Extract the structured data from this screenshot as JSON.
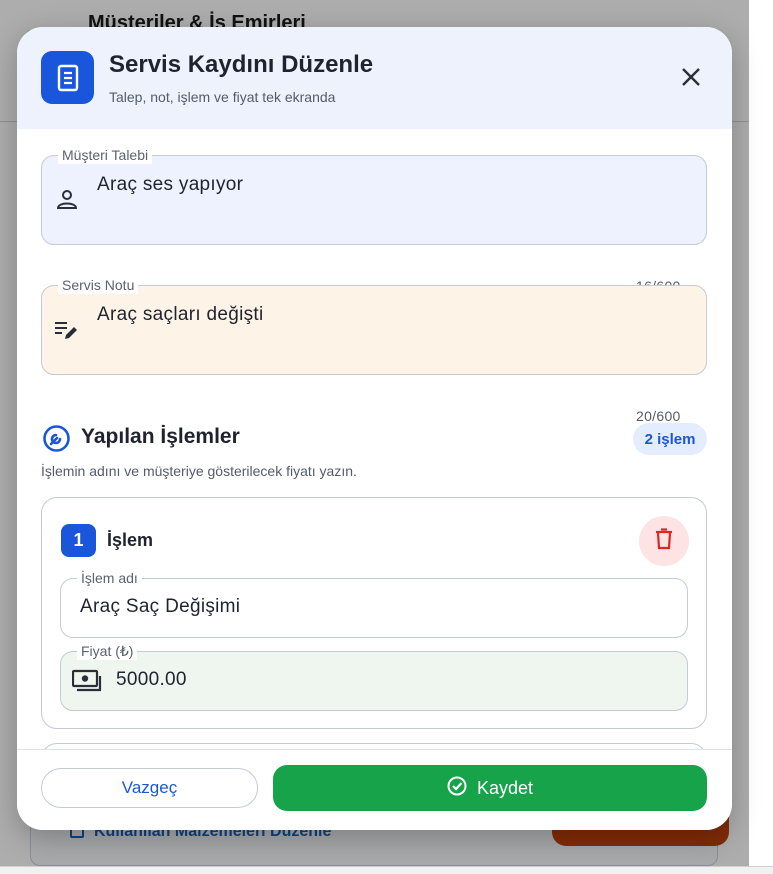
{
  "background": {
    "page_title": "Müşteriler & İş Emirleri",
    "back_icon": "arrow-left-icon",
    "link_label": "Kullanılan Malzemeleri Düzenle",
    "orange_accent": "#c2410c"
  },
  "dialog": {
    "title": "Servis Kaydını Düzenle",
    "subtitle": "Talep, not, işlem ve fiyat tek ekranda",
    "header_icon": "receipt-icon",
    "close_icon": "close-icon",
    "accent_color": "#1a56db"
  },
  "fields": {
    "request": {
      "label": "Müşteri Talebi",
      "value": "Araç ses yapıyor",
      "counter": "16/600",
      "icon": "person-icon",
      "bg_color": "#edf2fe"
    },
    "note": {
      "label": "Servis Notu",
      "value": "Araç saçları değişti",
      "counter": "20/600",
      "icon": "edit-note-icon",
      "bg_color": "#fdf3e7"
    }
  },
  "operations_section": {
    "title": "Yapılan İşlemler",
    "badge": "2 işlem",
    "description": "İşlemin adını ve müşteriye gösterilecek fiyatı yazın.",
    "icon": "wrench-icon",
    "items": [
      {
        "number": "1",
        "title": "İşlem",
        "name_label": "İşlem adı",
        "name_value": "Araç Saç Değişimi",
        "price_label": "Fiyat (₺)",
        "price_value": "5000.00",
        "price_icon": "money-icon",
        "delete_icon": "trash-icon"
      }
    ]
  },
  "footer": {
    "cancel_label": "Vazgeç",
    "save_label": "Kaydet",
    "save_icon": "check-circle-icon",
    "save_color": "#16a34a"
  }
}
